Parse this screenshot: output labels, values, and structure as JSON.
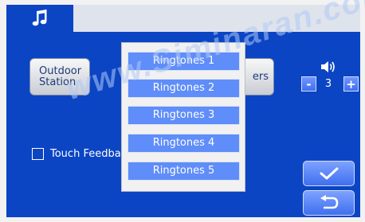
{
  "colors": {
    "panel_blue": "#0b45c4",
    "item_blue": "#5f8df9",
    "popup_bg": "#f1f1f1",
    "topbar": "#dfe3ec"
  },
  "header": {
    "app_icon": "music-note-icon"
  },
  "buttons": {
    "outdoor_station": "Outdoor\nStation",
    "ringers_partial": "ers"
  },
  "volume": {
    "icon": "speaker-icon",
    "minus": "-",
    "value": "3",
    "plus": "+"
  },
  "touch_feedback": {
    "label": "Touch Feedba",
    "checked": false
  },
  "ringtone_popup": {
    "items": [
      "Ringtones 1",
      "Ringtones 2",
      "Ringtones 3",
      "Ringtones 4",
      "Ringtones 5"
    ]
  },
  "actions": {
    "confirm_icon": "checkmark-icon",
    "back_icon": "return-arrow-icon"
  },
  "watermark": "www.Siminaran.com"
}
